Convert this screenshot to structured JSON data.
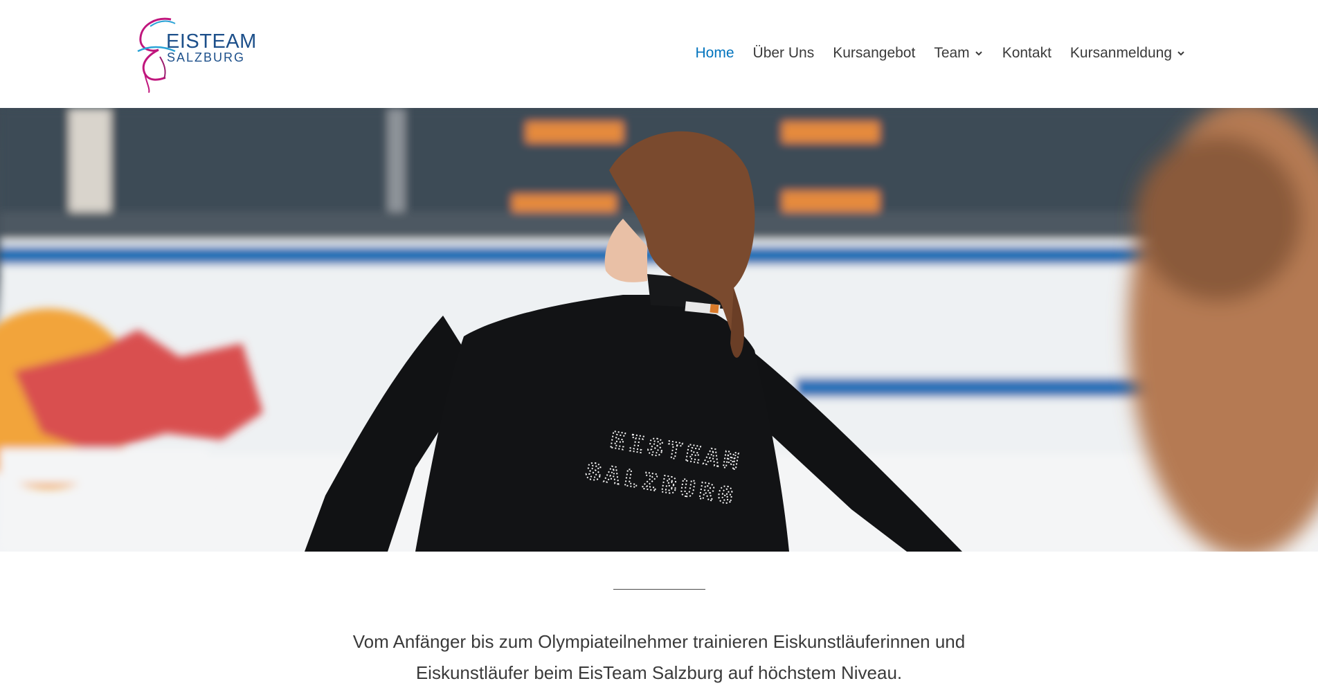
{
  "logo": {
    "line1": "EISTEAM",
    "line2": "SALZBURG",
    "brand_blue": "#1c4f8a",
    "brand_magenta": "#c0167d"
  },
  "nav": {
    "items": [
      {
        "label": "Home",
        "active": true,
        "has_dropdown": false
      },
      {
        "label": "Über Uns",
        "active": false,
        "has_dropdown": false
      },
      {
        "label": "Kursangebot",
        "active": false,
        "has_dropdown": false
      },
      {
        "label": "Team",
        "active": false,
        "has_dropdown": true
      },
      {
        "label": "Kontakt",
        "active": false,
        "has_dropdown": false
      },
      {
        "label": "Kursanmeldung",
        "active": false,
        "has_dropdown": true
      }
    ],
    "active_color": "#0274be",
    "text_color": "#3a3a3a"
  },
  "hero": {
    "jacket_line1": "EISTEAM",
    "jacket_line2": "SALZBURG"
  },
  "content": {
    "intro_line1": "Vom Anfänger bis zum Olympiateilnehmer trainieren Eiskunstläuferinnen und",
    "intro_line2": "Eiskunstläufer beim EisTeam Salzburg auf höchstem Niveau."
  }
}
